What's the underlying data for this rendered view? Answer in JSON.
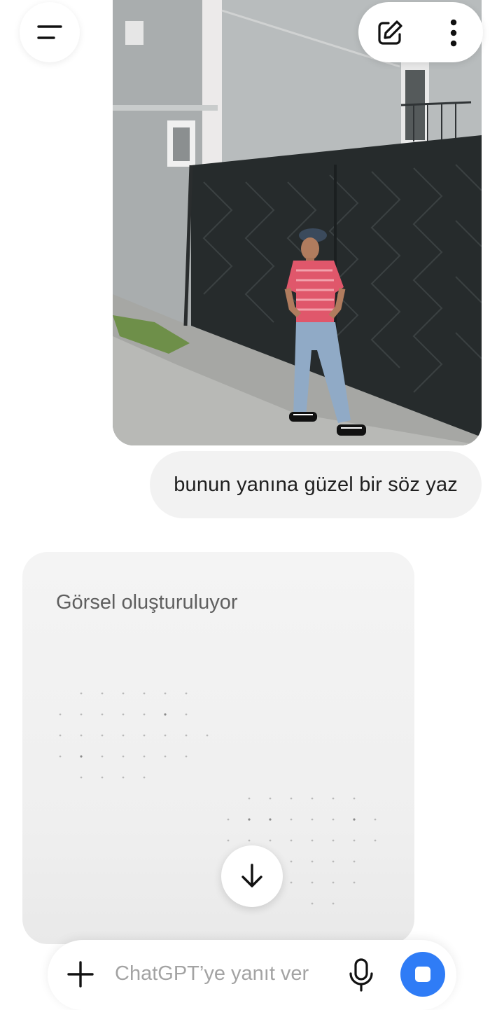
{
  "header": {
    "menu_icon": "hamburger-menu-icon",
    "new_chat_icon": "edit-pencil-icon",
    "more_icon": "vertical-dots-icon"
  },
  "conversation": {
    "user_message": "bunun yanına güzel bir söz yaz",
    "assistant_status": "Görsel oluşturuluyor"
  },
  "composer": {
    "placeholder": "ChatGPT’ye yanıt ver",
    "add_icon": "plus-icon",
    "mic_icon": "microphone-icon",
    "stop_icon": "stop-square-icon",
    "accent_color": "#2f7cf6"
  }
}
